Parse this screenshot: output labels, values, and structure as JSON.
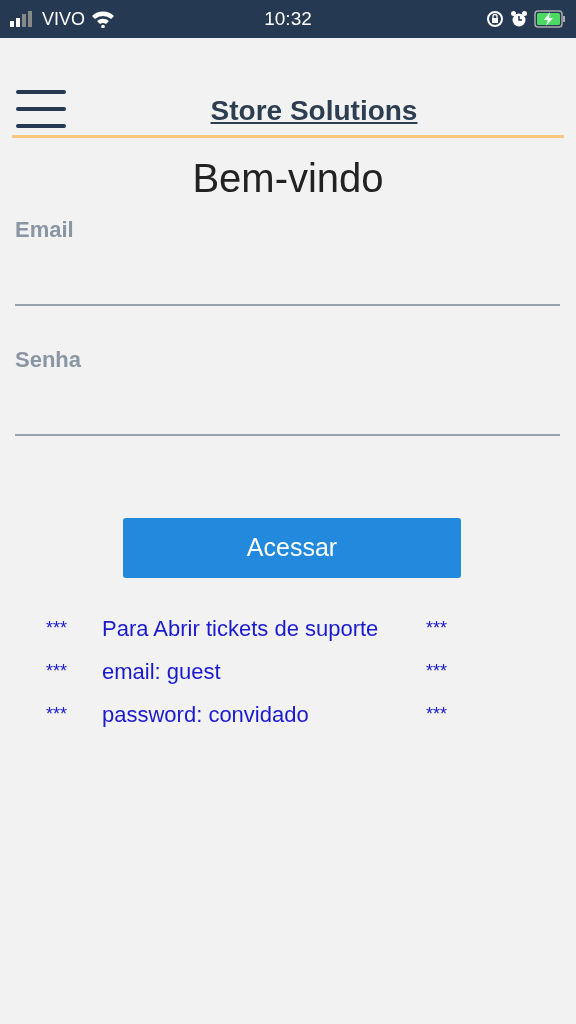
{
  "status_bar": {
    "carrier": "VIVO",
    "time": "10:32"
  },
  "header": {
    "title": "Store Solutions"
  },
  "heading": "Bem-vindo",
  "fields": [
    {
      "label": "Email"
    },
    {
      "label": "Senha"
    }
  ],
  "button": "Acessar",
  "notes": [
    {
      "left": "***",
      "text": "Para Abrir tickets de suporte",
      "right": "***"
    },
    {
      "left": "***",
      "text": "email: guest",
      "right": "***"
    },
    {
      "left": "***",
      "text": "password: convidado",
      "right": "***"
    }
  ]
}
